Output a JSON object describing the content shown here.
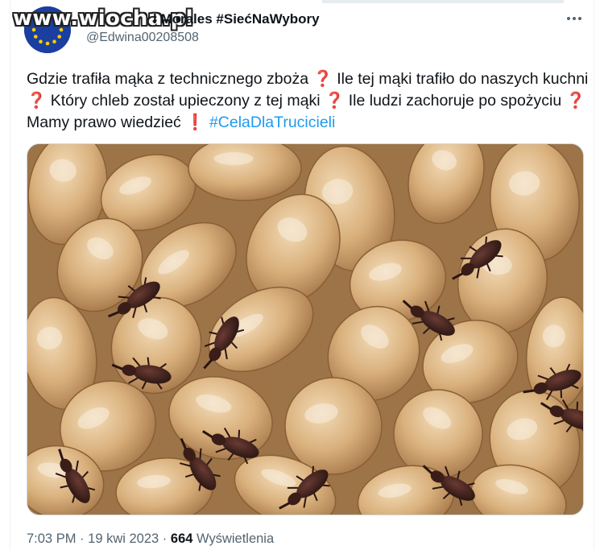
{
  "watermark": "www.wiocha.pl",
  "author": {
    "display_name": "l Morales #SiećNaWybory",
    "handle": "@Edwina00208508",
    "avatar": "eu-flag-avatar"
  },
  "tweet": {
    "segments": [
      "Gdzie trafiła mąka z technicznego zboża",
      "Ile tej mąki trafiło do naszych kuchni",
      "Który chleb został upieczony z tej mąki",
      "Ile ludzi zachoruje po spożyciu",
      "Mamy prawo wiedzieć",
      "#CelaDlaTrucicieli"
    ],
    "question_mark": "❓",
    "exclamation_mark": "❗"
  },
  "media": {
    "subject": "wheat-grains-with-weevils"
  },
  "meta": {
    "time": "7:03 PM",
    "separator": "·",
    "date": "19 kwi 2023",
    "views_count": "664",
    "views_label": "Wyświetlenia"
  },
  "colors": {
    "hashtag": "#1d9bf0",
    "secondary_text": "#536471",
    "primary_text": "#0f1419"
  },
  "icons": {
    "more": "more-horizontal-icon"
  }
}
